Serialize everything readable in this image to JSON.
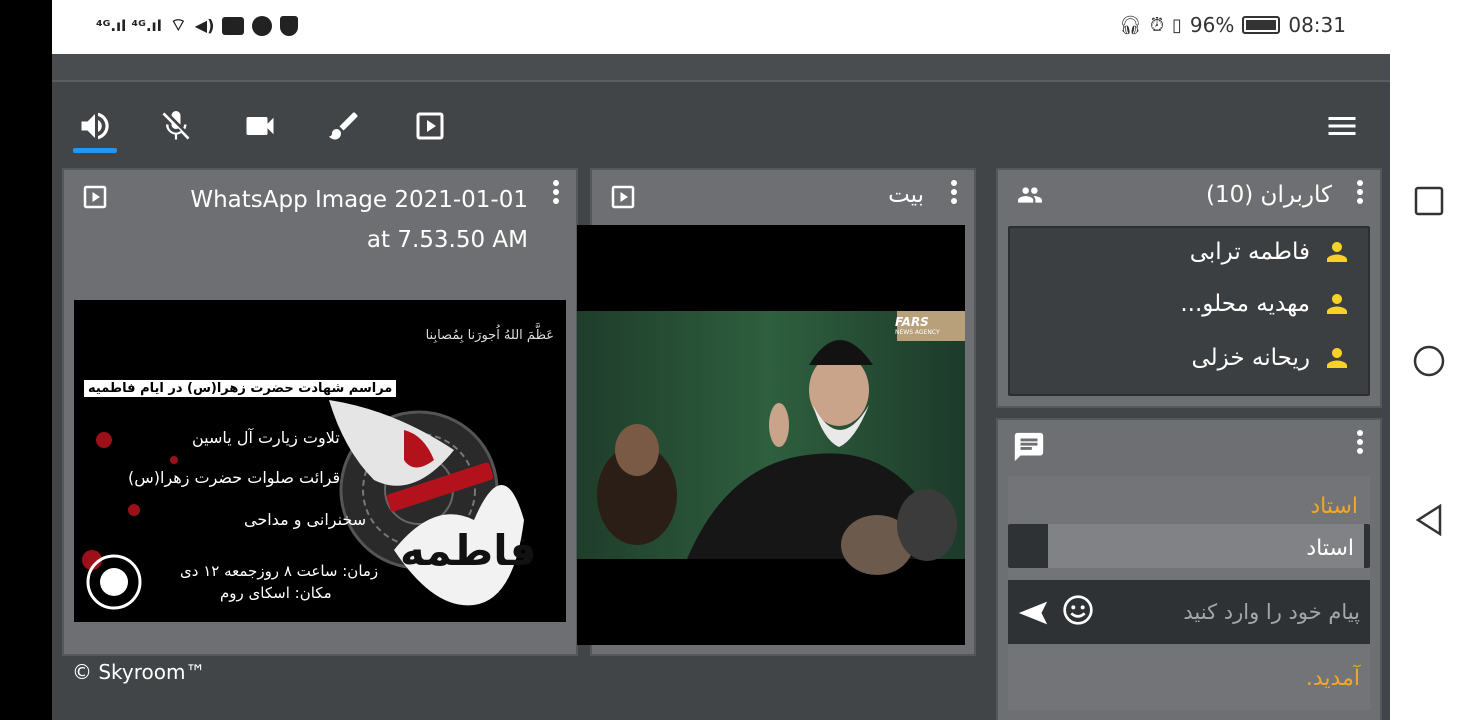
{
  "statusbar": {
    "left_text": "⁴ᴳ.ıl ⁴ᴳ.ıl",
    "battery": "96%",
    "time": "08:31"
  },
  "toolbar": {
    "speaker_icon": "speaker-icon",
    "mic_icon": "mic-off-icon",
    "camera_icon": "camera-icon",
    "brush_icon": "brush-icon",
    "play_icon": "play-box-icon",
    "menu_icon": "hamburger-icon"
  },
  "panels": {
    "media1": {
      "title": "WhatsApp Image 2021-01-01 at 7.53.50 AM"
    },
    "media2": {
      "title": "بیت"
    },
    "users": {
      "title": "کاربران (10)",
      "items": [
        {
          "name": "فاطمه ترابی"
        },
        {
          "name": "مهدیه محلو..."
        },
        {
          "name": "ریحانه خزلی"
        }
      ]
    },
    "chat": {
      "sender1": "استاد",
      "bubble_text": "استاد",
      "input_placeholder": "پیام خود را وارد کنید",
      "note": "آمدید."
    }
  },
  "poster": {
    "line1": "عَظَّمَ اللهُ اُجورَنا بِمُصابِنا",
    "line2": "مراسم شهادت حضرت زهرا(س) در ایام فاطمیه",
    "line3": "تلاوت زیارت آل یاسین",
    "line4": "قرائت صلوات حضرت زهرا(س)",
    "line5": "سخنرانی و مداحی",
    "line6": "زمان: ساعت ۸ روزجمعه ۱۲ دی",
    "line7": "مکان: اسکای روم",
    "big": "فاطمه"
  },
  "video": {
    "watermark": "FARS",
    "watermark_sub": "NEWS AGENCY"
  },
  "footer": {
    "copyright": "© Skyroom™"
  },
  "colors": {
    "accent": "#2196f3",
    "user_icon": "#f6d226",
    "chat_name": "#f5a623"
  }
}
